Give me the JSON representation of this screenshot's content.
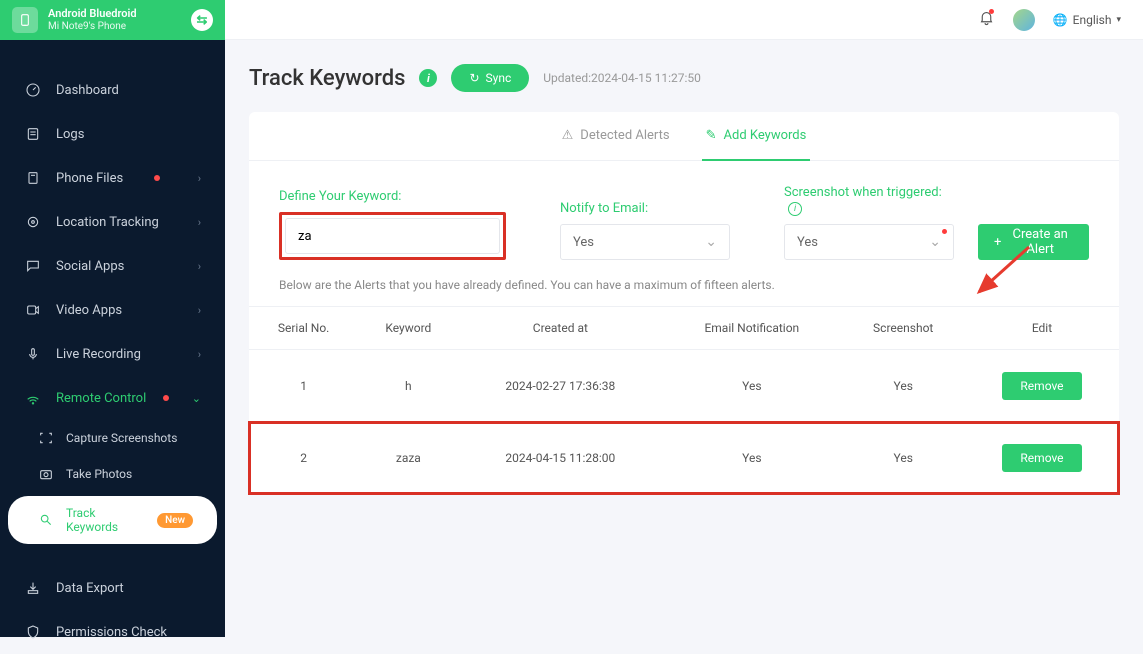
{
  "device": {
    "brand": "Android Bluedroid",
    "name": "Mi Note9's Phone"
  },
  "topbar": {
    "language": "English"
  },
  "sidebar": {
    "items": [
      {
        "label": "Dashboard"
      },
      {
        "label": "Logs"
      },
      {
        "label": "Phone Files"
      },
      {
        "label": "Location Tracking"
      },
      {
        "label": "Social Apps"
      },
      {
        "label": "Video Apps"
      },
      {
        "label": "Live Recording"
      },
      {
        "label": "Remote Control"
      },
      {
        "label": "Data Export"
      },
      {
        "label": "Permissions Check"
      }
    ],
    "sub": {
      "capture": "Capture Screenshots",
      "photos": "Take Photos",
      "keywords": "Track Keywords",
      "badge": "New"
    }
  },
  "page": {
    "title": "Track Keywords",
    "sync": "Sync",
    "updated": "Updated:2024-04-15 11:27:50"
  },
  "tabs": {
    "detected": "Detected Alerts",
    "add": "Add Keywords"
  },
  "form": {
    "define_label": "Define Your Keyword:",
    "keyword_value": "za",
    "notify_label": "Notify to Email:",
    "notify_value": "Yes",
    "screenshot_label": "Screenshot when triggered:",
    "screenshot_value": "Yes",
    "create_label": "Create an Alert"
  },
  "hint": "Below are the Alerts that you have already defined. You can have a maximum of fifteen alerts.",
  "table": {
    "headers": [
      "Serial No.",
      "Keyword",
      "Created at",
      "Email Notification",
      "Screenshot",
      "Edit"
    ],
    "rows": [
      {
        "serial": "1",
        "keyword": "h",
        "created": "2024-02-27 17:36:38",
        "email": "Yes",
        "screenshot": "Yes",
        "action": "Remove"
      },
      {
        "serial": "2",
        "keyword": "zaza",
        "created": "2024-04-15 11:28:00",
        "email": "Yes",
        "screenshot": "Yes",
        "action": "Remove"
      }
    ]
  }
}
